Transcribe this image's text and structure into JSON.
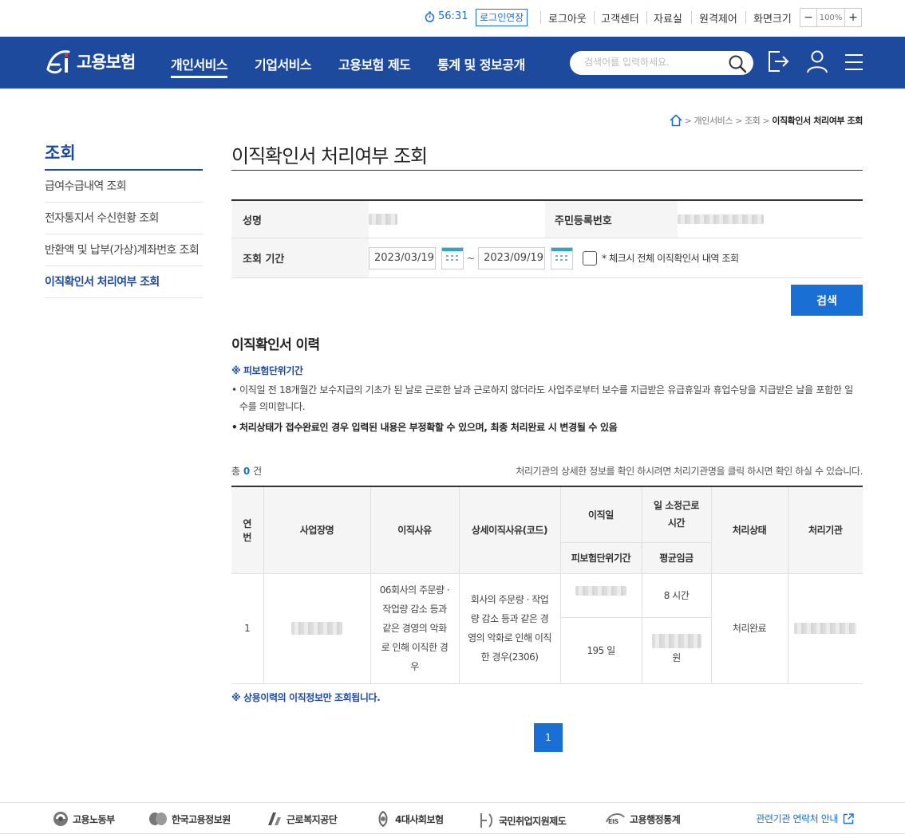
{
  "utility": {
    "timer": "56:31",
    "extend_label": "로그인연장",
    "links": [
      "로그아웃",
      "고객센터",
      "자료실",
      "원격제어",
      "화면크기"
    ],
    "zoom_minus": "−",
    "zoom_value": "100%",
    "zoom_plus": "+"
  },
  "nav": {
    "logo_text": "고용보험",
    "menus": [
      "개인서비스",
      "기업서비스",
      "고용보험 제도",
      "통계 및 정보공개"
    ],
    "search_placeholder": "검색어를 입력하세요."
  },
  "sidebar": {
    "title": "조회",
    "items": [
      {
        "label": "급여수급내역 조회"
      },
      {
        "label": "전자통지서 수신현황 조회"
      },
      {
        "label": "반환액 및 납부(가상)계좌번호 조회"
      },
      {
        "label": "이직확인서 처리여부 조회"
      }
    ]
  },
  "breadcrumb": {
    "items": [
      "개인서비스",
      "조회"
    ],
    "current": "이직확인서 처리여부 조회"
  },
  "page": {
    "title": "이직확인서 처리여부 조회"
  },
  "form": {
    "name_label": "성명",
    "rrn_label": "주민등록번호",
    "period_label": "조회 기간",
    "date_from": "2023/03/19",
    "tilde": "~",
    "date_to": "2023/09/19",
    "check_all_label": "* 체크시 전체 이직확인서 내역 조회",
    "search_button": "검색"
  },
  "history": {
    "title": "이직확인서 이력",
    "note_heading": "※ 피보험단위기간",
    "note_line1": "이직일 전 18개월간 보수지급의 기초가 된 날로 근로한 날과 근로하지 않더라도 사업주로부터 보수를 지급받은 유급휴일과 휴업수당을 지급받은 날을 포함한 일수를 의미합니다.",
    "note_line2": "처리상태가 접수완료인 경우 입력된 내용은 부정확할 수 있으며, 최종 처리완료 시 변경될 수 있음",
    "total_prefix": "총",
    "total_count": "0",
    "total_suffix": "건",
    "hint": "처리기관의 상세한 정보를 확인 하시려면 처리기관명을 클릭 하시면 확인 하실 수 있습니다.",
    "footnote": "※ 상용이력의 이직정보만 조회됩니다."
  },
  "table": {
    "headers": {
      "no": "연번",
      "company": "사업장명",
      "reason": "이직사유",
      "detail_reason": "상세이직사유(코드)",
      "leave_date": "이직일",
      "insured_period": "피보험단위기간",
      "work_hours": "일 소정근로 시간",
      "avg_wage": "평균임금",
      "status": "처리상태",
      "agency": "처리기관"
    },
    "rows": [
      {
        "no": "1",
        "reason": "06회사의 주문량 · 작업량 감소 등과 같은 경영의 악화로 인해 이직한 경우",
        "detail_reason": "회사의 주문량 · 작업량 감소 등과 같은 경영의 악화로 인해 이직한 경우(2306)",
        "work_hours": "8 시간",
        "insured_period": "195 일",
        "avg_wage_unit": "원",
        "status": "처리완료"
      }
    ]
  },
  "pagination": {
    "current": "1"
  },
  "footer": {
    "links": [
      "고용노동부",
      "한국고용정보원",
      "근로복지공단",
      "4대사회보험",
      "국민취업지원제도",
      "고용행정통계"
    ],
    "contact": "관련기관 연락처 안내"
  },
  "colors": {
    "primary": "#1e4a9e",
    "accent": "#1a6fd4"
  }
}
